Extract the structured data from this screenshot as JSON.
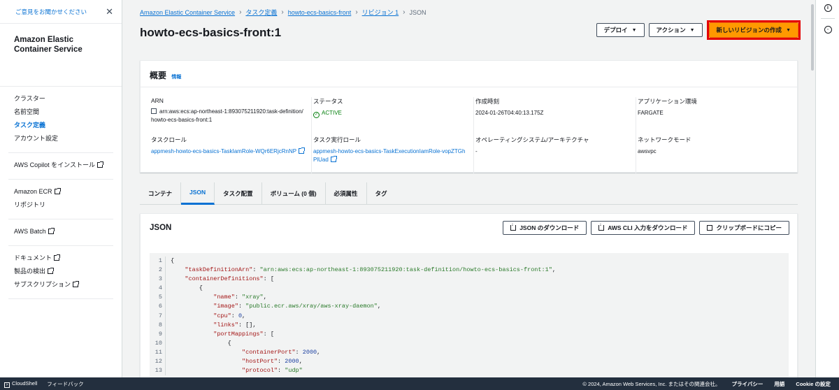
{
  "sidebar": {
    "feedback": "ご意見をお聞かせください",
    "title": "Amazon Elastic Container Service",
    "sections": [
      [
        {
          "label": "クラスター"
        },
        {
          "label": "名前空間"
        },
        {
          "label": "タスク定義",
          "active": true
        },
        {
          "label": "アカウント設定"
        }
      ],
      [
        {
          "label": "AWS Copilot をインストール",
          "ext": true
        }
      ],
      [
        {
          "label": "Amazon ECR",
          "ext": true
        },
        {
          "label": "リポジトリ"
        }
      ],
      [
        {
          "label": "AWS Batch",
          "ext": true
        }
      ],
      [
        {
          "label": "ドキュメント",
          "ext": true
        },
        {
          "label": "製品の検出",
          "ext": true
        },
        {
          "label": "サブスクリプション",
          "ext": true
        }
      ]
    ]
  },
  "breadcrumb": {
    "items": [
      "Amazon Elastic Container Service",
      "タスク定義",
      "howto-ecs-basics-front",
      "リビジョン 1"
    ],
    "current": "JSON"
  },
  "page": {
    "title": "howto-ecs-basics-front:1",
    "deploy": "デプロイ",
    "actions": "アクション",
    "create_revision": "新しいリビジョンの作成"
  },
  "overview": {
    "title": "概要",
    "info": "情報",
    "arn_label": "ARN",
    "arn_value": "arn:aws:ecs:ap-northeast-1:893075211920:task-definition/howto-ecs-basics-front:1",
    "status_label": "ステータス",
    "status_value": "ACTIVE",
    "created_label": "作成時刻",
    "created_value": "2024-01-26T04:40:13.175Z",
    "app_env_label": "アプリケーション環境",
    "app_env_value": "FARGATE",
    "task_role_label": "タスクロール",
    "task_role_value": "appmesh-howto-ecs-basics-TaskIamRole-WQr6ERjcRnNP",
    "exec_role_label": "タスク実行ロール",
    "exec_role_value": "appmesh-howto-ecs-basics-TaskExecutionIamRole-vopZTGhPlUad",
    "os_label": "オペレーティングシステム/アーキテクチャ",
    "os_value": "-",
    "network_label": "ネットワークモード",
    "network_value": "awsvpc"
  },
  "tabs": [
    "コンテナ",
    "JSON",
    "タスク配置",
    "ボリューム (0 個)",
    "必須属性",
    "タグ"
  ],
  "json_panel": {
    "title": "JSON",
    "download": "JSON のダウンロード",
    "cli_download": "AWS CLI 入力をダウンロード",
    "copy": "クリップボードにコピー"
  },
  "code_lines": [
    "1",
    "2",
    "3",
    "4",
    "5",
    "6",
    "7",
    "8",
    "9",
    "10",
    "11",
    "12",
    "13"
  ],
  "code_text": {
    "l2k": "\"taskDefinitionArn\"",
    "l2v": "\"arn:aws:ecs:ap-northeast-1:893075211920:task-definition/howto-ecs-basics-front:1\"",
    "l3k": "\"containerDefinitions\"",
    "l5k": "\"name\"",
    "l5v": "\"xray\"",
    "l6k": "\"image\"",
    "l6v": "\"public.ecr.aws/xray/aws-xray-daemon\"",
    "l7k": "\"cpu\"",
    "l7v": "0",
    "l8k": "\"links\"",
    "l9k": "\"portMappings\"",
    "l11k": "\"containerPort\"",
    "l11v": "2000",
    "l12k": "\"hostPort\"",
    "l12v": "2000",
    "l13k": "\"protocol\"",
    "l13v": "\"udp\""
  },
  "footer": {
    "cloudshell": "CloudShell",
    "feedback": "フィードバック",
    "copyright": "© 2024, Amazon Web Services, Inc. またはその関連会社。",
    "privacy": "プライバシー",
    "terms": "用語",
    "cookie": "Cookie の設定"
  },
  "colors": {
    "accent": "#0972d3",
    "primary_button": "#ff9900",
    "highlight_border": "#e40000",
    "footer_bg": "#232f3e",
    "status_active": "#037f0c"
  }
}
